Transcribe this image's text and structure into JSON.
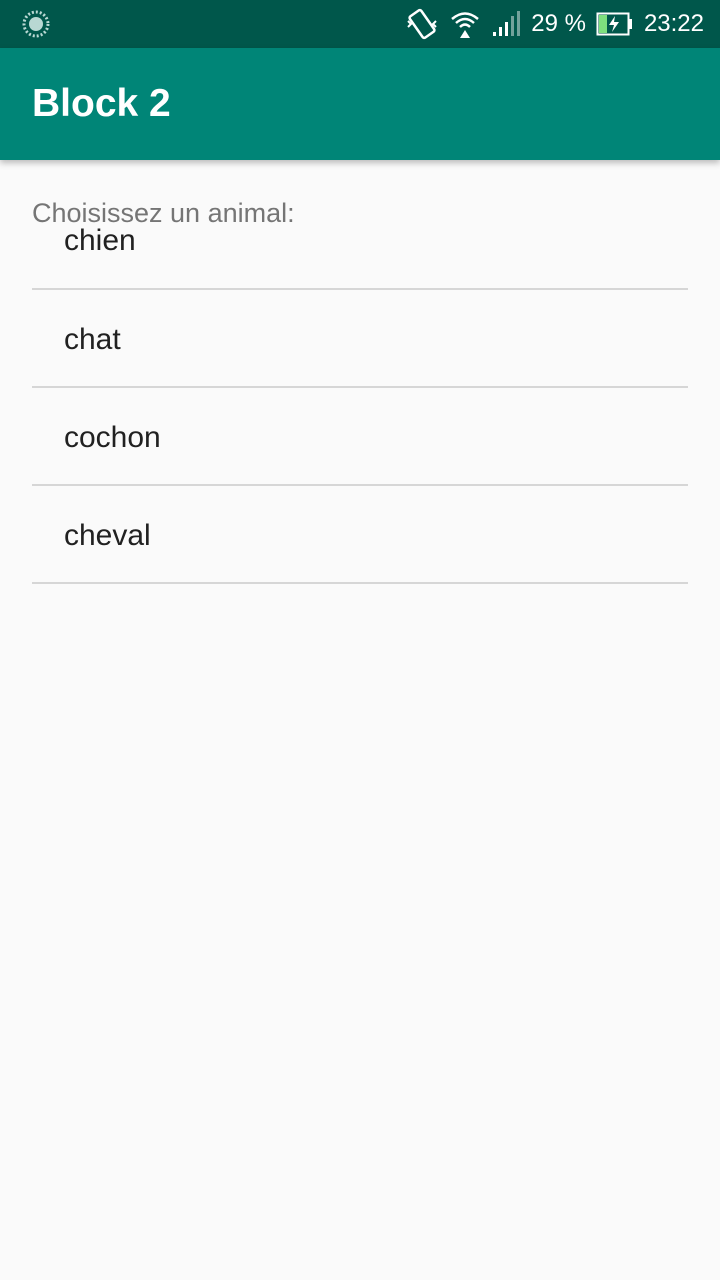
{
  "status_bar": {
    "battery_percent": "29 %",
    "time": "23:22",
    "icons": [
      "loading-circle-icon",
      "vibrate-rotate-icon",
      "wifi-icon",
      "signal-icon",
      "battery-charging-icon"
    ]
  },
  "app_bar": {
    "title": "Block 2",
    "color": "#008577"
  },
  "form": {
    "prompt": "Choisissez un animal:",
    "options": [
      {
        "label": "chien"
      },
      {
        "label": "chat"
      },
      {
        "label": "cochon"
      },
      {
        "label": "cheval"
      }
    ]
  },
  "colors": {
    "status_bar": "#00574b",
    "background": "#fafafa",
    "divider": "#d6d6d6"
  }
}
